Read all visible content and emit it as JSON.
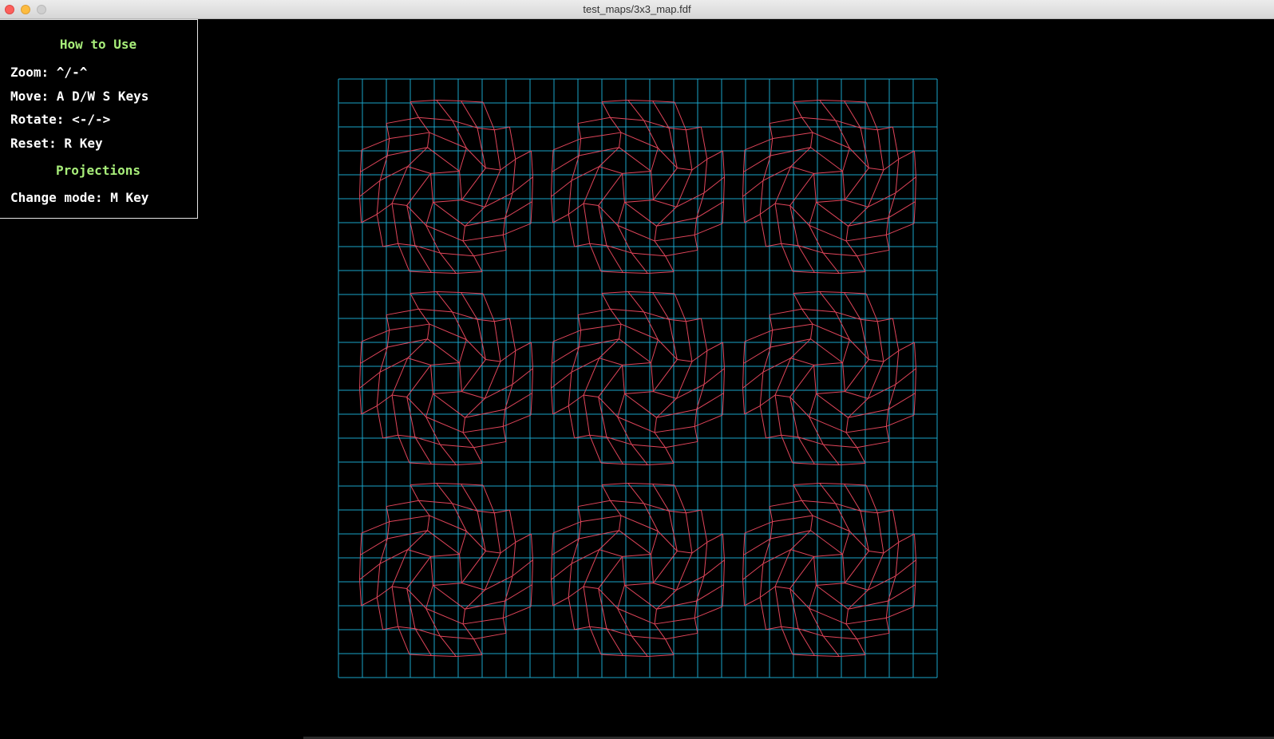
{
  "window": {
    "title": "test_maps/3x3_map.fdf"
  },
  "help": {
    "heading": "How to Use",
    "zoom": "Zoom: ^/-^",
    "move": "Move: A D/W S Keys",
    "rotate": "Rotate: <-/->",
    "reset": "Reset: R Key",
    "projections_heading": "Projections",
    "change_mode": "Change mode: M Key"
  },
  "colors": {
    "grid": "#1aa3c8",
    "terrain": "#e0455a",
    "heading": "#a8ee7a",
    "text": "#ffffff"
  },
  "map": {
    "grid_size": 25,
    "bump_centers": [
      [
        4.5,
        4.5
      ],
      [
        12.5,
        4.5
      ],
      [
        20.5,
        4.5
      ],
      [
        4.5,
        12.5
      ],
      [
        12.5,
        12.5
      ],
      [
        20.5,
        12.5
      ],
      [
        4.5,
        20.5
      ],
      [
        12.5,
        20.5
      ],
      [
        20.5,
        20.5
      ]
    ]
  }
}
